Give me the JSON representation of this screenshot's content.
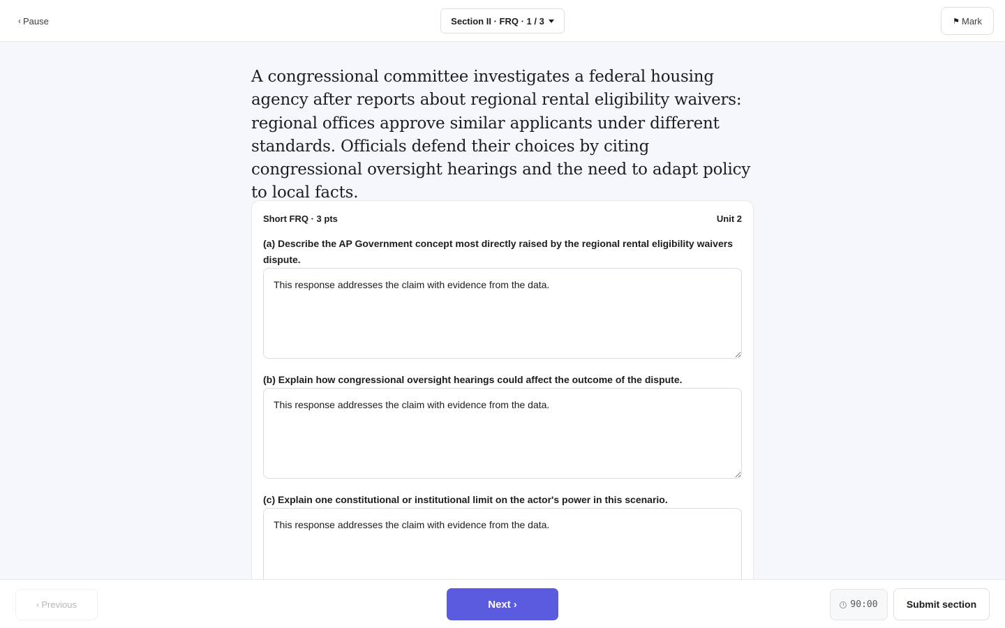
{
  "topbar": {
    "pause_label": "Pause",
    "section_label": "Section II · FRQ · 1 / 3",
    "mark_label": "Mark"
  },
  "prompt": {
    "text": "A congressional committee investigates a federal housing agency after reports about regional rental eligibility waivers: regional offices approve similar applicants under different standards. Officials defend their choices by citing congressional oversight hearings and the need to adapt policy to local facts."
  },
  "card": {
    "type_label": "Short FRQ · 3 pts",
    "unit_label": "Unit 2",
    "parts": [
      {
        "label": "(a) Describe the AP Government concept most directly raised by the regional rental eligibility waivers dispute.",
        "answer": "This response addresses the claim with evidence from the data."
      },
      {
        "label": "(b) Explain how congressional oversight hearings could affect the outcome of the dispute.",
        "answer": "This response addresses the claim with evidence from the data."
      },
      {
        "label": "(c) Explain one constitutional or institutional limit on the actor's power in this scenario.",
        "answer": "This response addresses the claim with evidence from the data."
      }
    ]
  },
  "bottombar": {
    "previous_label": "Previous",
    "next_label": "Next",
    "timer": "90:00",
    "submit_label": "Submit section"
  },
  "colors": {
    "accent": "#5b5bdf",
    "background": "#f6f7fa"
  }
}
